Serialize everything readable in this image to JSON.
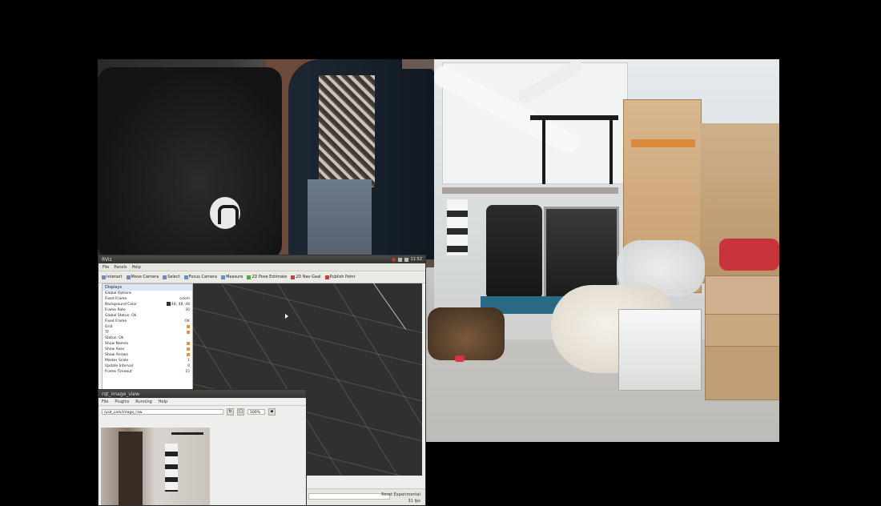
{
  "rviz": {
    "title": "RViz",
    "tray_clock": "11:52",
    "menu": [
      "File",
      "Panels",
      "Help"
    ],
    "toolbar": [
      {
        "label": "Interact",
        "icon": "cursor-icon"
      },
      {
        "label": "Move Camera",
        "icon": "move-icon"
      },
      {
        "label": "Select",
        "icon": "select-icon"
      },
      {
        "label": "Focus Camera",
        "icon": "focus-icon"
      },
      {
        "label": "Measure",
        "icon": "ruler-icon"
      },
      {
        "label": "2D Pose Estimate",
        "icon": "arrow-green-icon"
      },
      {
        "label": "2D Nav Goal",
        "icon": "arrow-pink-icon"
      },
      {
        "label": "Publish Point",
        "icon": "pin-red-icon"
      }
    ],
    "displays_title": "Displays",
    "displays": [
      {
        "label": "Global Options",
        "value": ""
      },
      {
        "label": "Fixed Frame",
        "value": "odom"
      },
      {
        "label": "Background Color",
        "value": "48; 48; 48"
      },
      {
        "label": "Frame Rate",
        "value": "30"
      },
      {
        "label": "Global Status: Ok",
        "value": ""
      },
      {
        "label": "Fixed Frame",
        "value": "OK"
      },
      {
        "label": "Grid",
        "value": ""
      },
      {
        "label": "TF",
        "value": ""
      },
      {
        "label": "Status: Ok",
        "value": ""
      },
      {
        "label": "Show Names",
        "value": ""
      },
      {
        "label": "Show Axes",
        "value": ""
      },
      {
        "label": "Show Arrows",
        "value": ""
      },
      {
        "label": "Marker Scale",
        "value": "1"
      },
      {
        "label": "Update Interval",
        "value": "0"
      },
      {
        "label": "Frame Timeout",
        "value": "15"
      }
    ],
    "status_right": "Reset  Experimental",
    "status_fps": "31 fps"
  },
  "image_view": {
    "title": "rqt_image_view",
    "menu": [
      "File",
      "Plugins",
      "Running",
      "Help"
    ],
    "topic": "/usb_cam/image_raw",
    "zoom": "100%"
  }
}
